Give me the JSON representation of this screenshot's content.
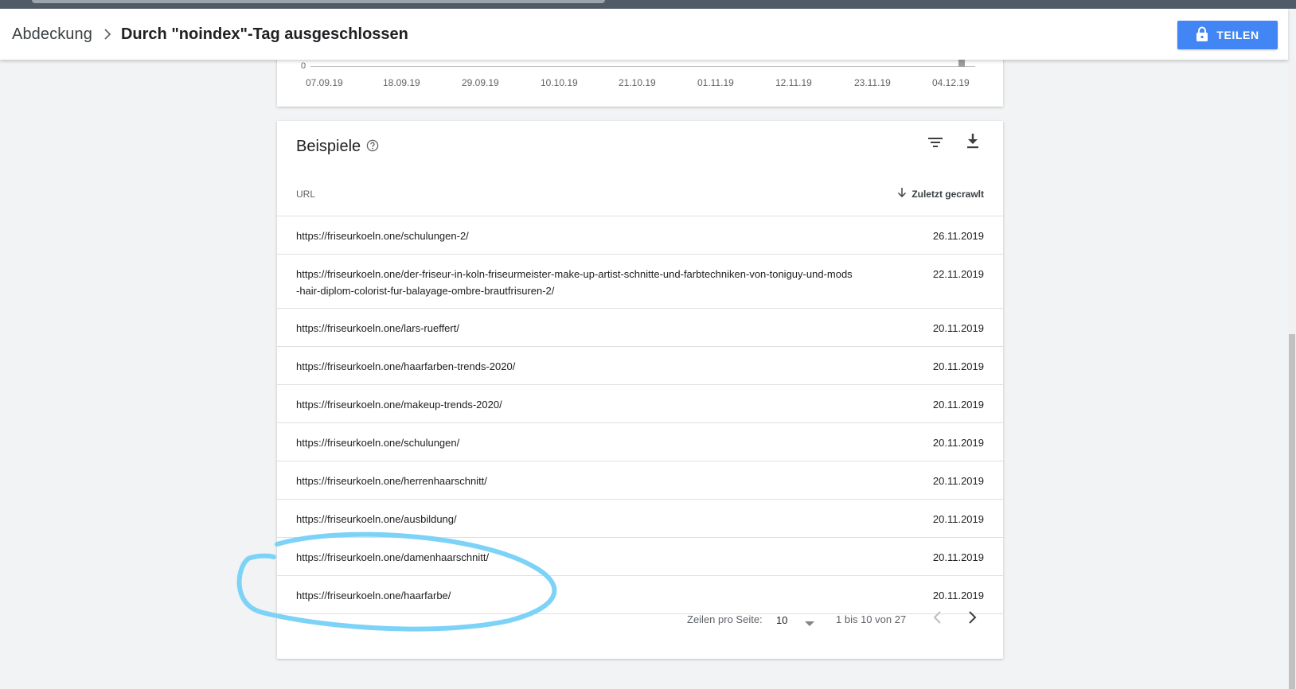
{
  "header": {
    "breadcrumb_parent": "Abdeckung",
    "breadcrumb_current": "Durch \"noindex\"-Tag ausgeschlossen",
    "share_label": "TEILEN"
  },
  "chart": {
    "zero_label": "0",
    "ticks": [
      "07.09.19",
      "18.09.19",
      "29.09.19",
      "10.10.19",
      "21.10.19",
      "01.11.19",
      "12.11.19",
      "23.11.19",
      "04.12.19"
    ]
  },
  "examples": {
    "title": "Beispiele",
    "col_url": "URL",
    "col_date": "Zuletzt gecrawlt",
    "rows": [
      {
        "url": "https://friseurkoeln.one/schulungen-2/",
        "date": "26.11.2019"
      },
      {
        "url": "https://friseurkoeln.one/der-friseur-in-koln-friseurmeister-make-up-artist-schnitte-und-farbtechniken-von-toniguy-und-mods-hair-diplom-colorist-fur-balayage-ombre-brautfrisuren-2/",
        "date": "22.11.2019"
      },
      {
        "url": "https://friseurkoeln.one/lars-rueffert/",
        "date": "20.11.2019"
      },
      {
        "url": "https://friseurkoeln.one/haarfarben-trends-2020/",
        "date": "20.11.2019"
      },
      {
        "url": "https://friseurkoeln.one/makeup-trends-2020/",
        "date": "20.11.2019"
      },
      {
        "url": "https://friseurkoeln.one/schulungen/",
        "date": "20.11.2019"
      },
      {
        "url": "https://friseurkoeln.one/herrenhaarschnitt/",
        "date": "20.11.2019"
      },
      {
        "url": "https://friseurkoeln.one/ausbildung/",
        "date": "20.11.2019"
      },
      {
        "url": "https://friseurkoeln.one/damenhaarschnitt/",
        "date": "20.11.2019"
      },
      {
        "url": "https://friseurkoeln.one/haarfarbe/",
        "date": "20.11.2019"
      }
    ],
    "pagination": {
      "rows_label": "Zeilen pro Seite:",
      "rows_value": "10",
      "range": "1 bis 10 von 27"
    }
  },
  "colors": {
    "accent": "#4285f4",
    "annotation": "#7dd3f7"
  },
  "icons": [
    "chevron-right-icon",
    "lock-icon",
    "help-icon",
    "filter-icon",
    "download-icon",
    "arrow-down-icon",
    "caret-down-icon",
    "chevron-left-icon"
  ]
}
